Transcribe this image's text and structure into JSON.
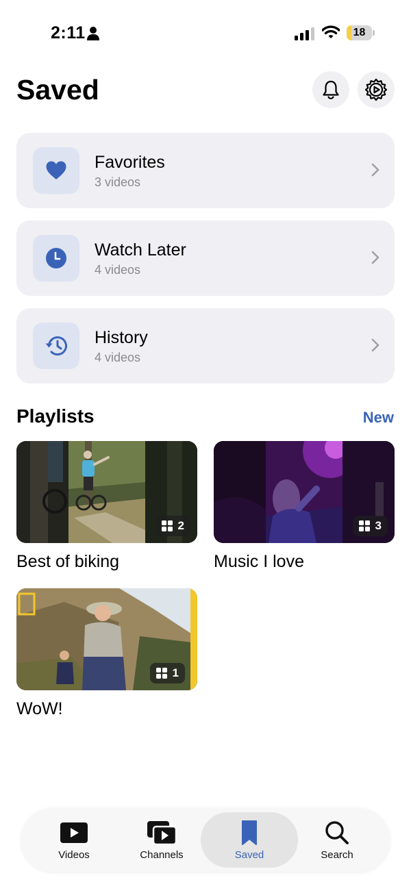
{
  "status_bar": {
    "time": "2:11",
    "battery_percent": "18",
    "battery_level": 0.18
  },
  "header": {
    "title": "Saved",
    "bell_icon": "bell-icon",
    "settings_icon": "gear-play-icon"
  },
  "saved_items": [
    {
      "title": "Favorites",
      "subtitle": "3 videos",
      "icon": "heart-icon"
    },
    {
      "title": "Watch Later",
      "subtitle": "4 videos",
      "icon": "clock-icon"
    },
    {
      "title": "History",
      "subtitle": "4 videos",
      "icon": "history-icon"
    }
  ],
  "playlists": {
    "section_title": "Playlists",
    "new_label": "New",
    "items": [
      {
        "title": "Best of biking",
        "count": "2"
      },
      {
        "title": "Music I love",
        "count": "3"
      },
      {
        "title": "WoW!",
        "count": "1"
      }
    ]
  },
  "tab_bar": {
    "tabs": [
      {
        "label": "Videos",
        "icon": "play-rectangle-icon"
      },
      {
        "label": "Channels",
        "icon": "stacked-play-icon"
      },
      {
        "label": "Saved",
        "icon": "bookmark-icon",
        "active": true
      },
      {
        "label": "Search",
        "icon": "search-icon"
      }
    ]
  },
  "colors": {
    "accent": "#3a63b8",
    "card_bg": "#efeff4",
    "icon_bg": "#dde3f1",
    "battery_yellow": "#f5cf48"
  }
}
